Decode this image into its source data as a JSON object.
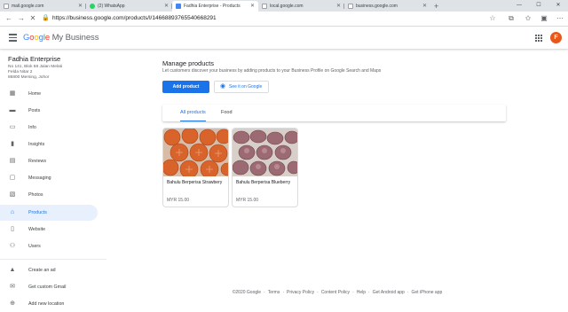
{
  "browser": {
    "tabs": [
      {
        "label": "mail.google.com",
        "icon": "mail-favicon",
        "active": false
      },
      {
        "label": "(2) WhatsApp",
        "icon": "whatsapp-favicon",
        "active": false
      },
      {
        "label": "Fadhia Enterprise - Products",
        "icon": "gmb-favicon",
        "active": true
      },
      {
        "label": "local.google.com",
        "icon": "doc-favicon",
        "active": false
      },
      {
        "label": "business.google.com",
        "icon": "doc-favicon",
        "active": false
      }
    ],
    "url": "https://business.google.com/products/l/14668893765540668291"
  },
  "header": {
    "logo_g": "G",
    "logo_o1": "o",
    "logo_o2": "o",
    "logo_g2": "g",
    "logo_l": "l",
    "logo_e": "e",
    "logo_suffix": " My Business",
    "avatar_letter": "F",
    "avatar_color": "#e8581c"
  },
  "business": {
    "name": "Fadhia Enterprise",
    "address_lines": [
      "No 141, Blok 68 Jalan Melati",
      "Felda Nitar 2",
      "86800 Mersing, Johor"
    ]
  },
  "sidebar": {
    "items": [
      {
        "label": "Home",
        "icon": "home-icon"
      },
      {
        "label": "Posts",
        "icon": "posts-icon"
      },
      {
        "label": "Info",
        "icon": "info-icon"
      },
      {
        "label": "Insights",
        "icon": "insights-icon"
      },
      {
        "label": "Reviews",
        "icon": "reviews-icon"
      },
      {
        "label": "Messaging",
        "icon": "messaging-icon"
      },
      {
        "label": "Photos",
        "icon": "photos-icon"
      },
      {
        "label": "Products",
        "icon": "products-icon",
        "active": true
      },
      {
        "label": "Website",
        "icon": "website-icon"
      },
      {
        "label": "Users",
        "icon": "users-icon"
      },
      {
        "label": "Create an ad",
        "icon": "ads-icon"
      },
      {
        "label": "Get custom Gmail",
        "icon": "gmail-icon"
      },
      {
        "label": "Add new location",
        "icon": "add-location-icon"
      }
    ]
  },
  "main": {
    "title": "Manage products",
    "subtitle": "Let customers discover your business by adding products to your Business Profile on Google Search and Maps",
    "add_button": "Add product",
    "see_button": "See it on Google",
    "tabs": [
      {
        "label": "All products",
        "active": true
      },
      {
        "label": "Food",
        "active": false
      }
    ],
    "products": [
      {
        "name": "Bahulu Berperisa Strawbery",
        "price": "MYR 15.00",
        "color": "#d9642b"
      },
      {
        "name": "Bahulu Berperisa Blueberry",
        "price": "MYR 15.00",
        "color": "#9c6a72"
      }
    ]
  },
  "footer": {
    "links": [
      "©2020 Google",
      "Terms",
      "Privacy Policy",
      "Content Policy",
      "Help",
      "Get Android app",
      "Get iPhone app"
    ]
  },
  "colors": {
    "accent": "#1a73e8",
    "active_bg": "#e8f0fe"
  }
}
